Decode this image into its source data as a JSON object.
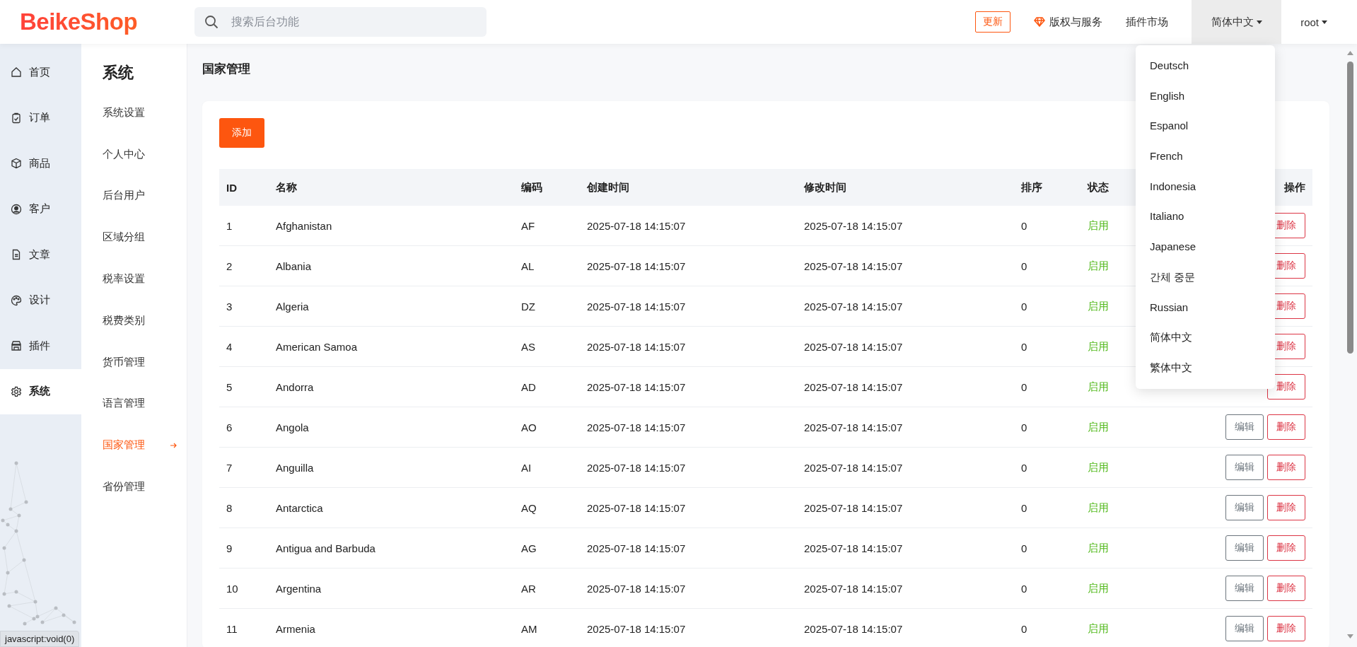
{
  "header": {
    "logo": "BeikeShop",
    "search": {
      "placeholder": "搜索后台功能"
    },
    "update_button": "更新",
    "copyright_link": "版权与服务",
    "plugin_market_link": "插件市场",
    "language": {
      "label": "简体中文",
      "expanded": true
    },
    "user": "root"
  },
  "language_menu": [
    "Deutsch",
    "English",
    "Espanol",
    "French",
    "Indonesia",
    "Italiano",
    "Japanese",
    "간체 중문",
    "Russian",
    "简体中文",
    "繁体中文"
  ],
  "rail": [
    {
      "label": "首页",
      "selected": false
    },
    {
      "label": "订单",
      "selected": false
    },
    {
      "label": "商品",
      "selected": false
    },
    {
      "label": "客户",
      "selected": false
    },
    {
      "label": "文章",
      "selected": false
    },
    {
      "label": "设计",
      "selected": false
    },
    {
      "label": "插件",
      "selected": false
    },
    {
      "label": "系统",
      "selected": true
    }
  ],
  "subnav": {
    "title": "系统",
    "items": [
      {
        "label": "系统设置",
        "selected": false
      },
      {
        "label": "个人中心",
        "selected": false
      },
      {
        "label": "后台用户",
        "selected": false
      },
      {
        "label": "区域分组",
        "selected": false
      },
      {
        "label": "税率设置",
        "selected": false
      },
      {
        "label": "税费类别",
        "selected": false
      },
      {
        "label": "货币管理",
        "selected": false
      },
      {
        "label": "语言管理",
        "selected": false
      },
      {
        "label": "国家管理",
        "selected": true
      },
      {
        "label": "省份管理",
        "selected": false
      }
    ]
  },
  "page_title": "国家管理",
  "add_button": "添加",
  "table": {
    "columns": [
      "ID",
      "名称",
      "编码",
      "创建时间",
      "修改时间",
      "排序",
      "状态",
      "操作"
    ],
    "rows": [
      {
        "id": "1",
        "name": "Afghanistan",
        "code": "AF",
        "created": "2025-07-18 14:15:07",
        "modified": "2025-07-18 14:15:07",
        "sort": "0",
        "status": "启用",
        "actions": [
          {
            "kind": "delete",
            "label": "删除"
          }
        ]
      },
      {
        "id": "2",
        "name": "Albania",
        "code": "AL",
        "created": "2025-07-18 14:15:07",
        "modified": "2025-07-18 14:15:07",
        "sort": "0",
        "status": "启用",
        "actions": [
          {
            "kind": "delete",
            "label": "删除"
          }
        ]
      },
      {
        "id": "3",
        "name": "Algeria",
        "code": "DZ",
        "created": "2025-07-18 14:15:07",
        "modified": "2025-07-18 14:15:07",
        "sort": "0",
        "status": "启用",
        "actions": [
          {
            "kind": "delete",
            "label": "删除"
          }
        ]
      },
      {
        "id": "4",
        "name": "American Samoa",
        "code": "AS",
        "created": "2025-07-18 14:15:07",
        "modified": "2025-07-18 14:15:07",
        "sort": "0",
        "status": "启用",
        "actions": [
          {
            "kind": "delete",
            "label": "删除"
          }
        ]
      },
      {
        "id": "5",
        "name": "Andorra",
        "code": "AD",
        "created": "2025-07-18 14:15:07",
        "modified": "2025-07-18 14:15:07",
        "sort": "0",
        "status": "启用",
        "actions": [
          {
            "kind": "delete",
            "label": "删除"
          }
        ]
      },
      {
        "id": "6",
        "name": "Angola",
        "code": "AO",
        "created": "2025-07-18 14:15:07",
        "modified": "2025-07-18 14:15:07",
        "sort": "0",
        "status": "启用",
        "actions": [
          {
            "kind": "edit",
            "label": "编辑"
          },
          {
            "kind": "delete",
            "label": "删除"
          }
        ]
      },
      {
        "id": "7",
        "name": "Anguilla",
        "code": "AI",
        "created": "2025-07-18 14:15:07",
        "modified": "2025-07-18 14:15:07",
        "sort": "0",
        "status": "启用",
        "actions": [
          {
            "kind": "edit",
            "label": "编辑"
          },
          {
            "kind": "delete",
            "label": "删除"
          }
        ]
      },
      {
        "id": "8",
        "name": "Antarctica",
        "code": "AQ",
        "created": "2025-07-18 14:15:07",
        "modified": "2025-07-18 14:15:07",
        "sort": "0",
        "status": "启用",
        "actions": [
          {
            "kind": "edit",
            "label": "编辑"
          },
          {
            "kind": "delete",
            "label": "删除"
          }
        ]
      },
      {
        "id": "9",
        "name": "Antigua and Barbuda",
        "code": "AG",
        "created": "2025-07-18 14:15:07",
        "modified": "2025-07-18 14:15:07",
        "sort": "0",
        "status": "启用",
        "actions": [
          {
            "kind": "edit",
            "label": "编辑"
          },
          {
            "kind": "delete",
            "label": "删除"
          }
        ]
      },
      {
        "id": "10",
        "name": "Argentina",
        "code": "AR",
        "created": "2025-07-18 14:15:07",
        "modified": "2025-07-18 14:15:07",
        "sort": "0",
        "status": "启用",
        "actions": [
          {
            "kind": "edit",
            "label": "编辑"
          },
          {
            "kind": "delete",
            "label": "删除"
          }
        ]
      },
      {
        "id": "11",
        "name": "Armenia",
        "code": "AM",
        "created": "2025-07-18 14:15:07",
        "modified": "2025-07-18 14:15:07",
        "sort": "0",
        "status": "启用",
        "actions": [
          {
            "kind": "edit",
            "label": "编辑"
          },
          {
            "kind": "delete",
            "label": "删除"
          }
        ]
      }
    ]
  },
  "status_bar": "javascript:void(0)"
}
